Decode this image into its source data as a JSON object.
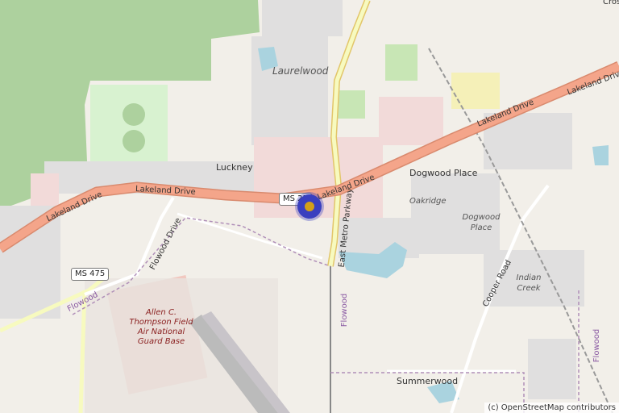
{
  "map": {
    "labels": {
      "laurelwood": "Laurelwood",
      "luckney": "Luckney",
      "dogwood_place": "Dogwood Place",
      "oakridge": "Oakridge",
      "dogwood_place_area": "Dogwood Place",
      "indian_creek": "Indian Creek",
      "summerwood": "Summerwood",
      "cross": "Cross",
      "flowood_1": "Flowood",
      "flowood_2": "Flowood",
      "flowood_3": "Flowood",
      "airbase": "Allen C. Thompson Field Air National Guard Base"
    },
    "roads": {
      "lakeland_drive_west": "Lakeland Drive",
      "lakeland_drive_center": "Lakeland Drive",
      "lakeland_drive_east_1": "Lakeland Drive",
      "lakeland_drive_east_2": "Lakeland Drive",
      "east_metro_parkway": "East Metro Parkway",
      "flowood_drive": "Flowood Drive",
      "cooper_road": "Cooper Road"
    },
    "shields": {
      "ms25": "MS 25",
      "ms475": "MS 475"
    },
    "attribution": "(c) OpenStreetMap contributors",
    "colors": {
      "background": "#f2efe9",
      "forest": "#add19e",
      "primary_road": "#f4a58a",
      "secondary_road": "#f7fabf",
      "water": "#aad3df",
      "residential": "#e0dfdf",
      "commercial": "#f2dad9",
      "military": "#f1c8c0",
      "marker": "#3a3fbf",
      "marker_center": "#d4a017"
    }
  }
}
